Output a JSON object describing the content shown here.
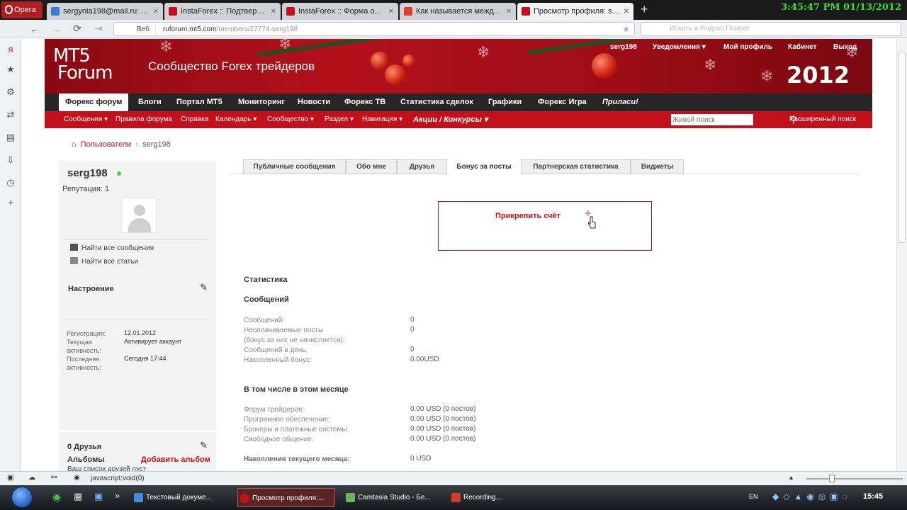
{
  "browser": {
    "menu_label": "Opera",
    "tabs": [
      {
        "title": "sergynia198@mail.ru: Д...",
        "favicon_color": "#3b7bd0"
      },
      {
        "title": "InstaForex :: Подтверж...",
        "favicon_color": "#c3101b"
      },
      {
        "title": "InstaForex :: Форма отк...",
        "favicon_color": "#c3101b"
      },
      {
        "title": "Как называется между...",
        "favicon_color": "#e23b2e"
      },
      {
        "title": "Просмотр профиля: ser...",
        "favicon_color": "#c3101b"
      }
    ],
    "clock": "3:45:47 PM 01/13/2012",
    "address": {
      "prefix": "Веб",
      "url_host": "ruforum.mt5.com",
      "url_path": "/members/27774-serg198"
    },
    "search_placeholder": "Искать в Яндекс.Поиске"
  },
  "site": {
    "logo_line1": "MT5",
    "logo_line2": "Forum",
    "tagline": "Сообщество Forex трейдеров",
    "year": "2012",
    "topnav": [
      "serg198",
      "Уведомления ▾",
      "Мой профиль",
      "Кабинет",
      "Выход"
    ],
    "main_menu": [
      "Форекс форум",
      "Блоги",
      "Портал MT5",
      "Мониторинг",
      "Новости",
      "Форекс ТВ",
      "Статистика сделок",
      "Графики",
      "Форекс Игра",
      "Приласи!"
    ],
    "sub_menu": [
      "Сообщения ▾",
      "Правила форума",
      "Справка",
      "Календарь ▾",
      "Сообщество ▾",
      "Раздел ▾",
      "Навигация ▾",
      "Акции / Конкурсы ▾"
    ],
    "live_search_placeholder": "Живой поиск",
    "advanced_search": "Расширенный поиск"
  },
  "breadcrumb": {
    "parent": "Пользователи",
    "current": "serg198"
  },
  "profile": {
    "username": "serg198",
    "reputation": "Репутация: 1",
    "find_posts": "Найти все сообщения",
    "find_articles": "Найти все статьи",
    "mood_title": "Настроение",
    "info": [
      {
        "label": "Регистрация:",
        "value": "12.01.2012"
      },
      {
        "label": "Текущая активность:",
        "value": "Активирует аккаунт"
      },
      {
        "label": "Последняя активность:",
        "value": "Сегодня 17:44"
      }
    ],
    "friends_title": "0 Друзья",
    "friends_empty": "Ваш список друзей пуст",
    "albums_title": "Альбомы",
    "add_album": "Добавить альбом"
  },
  "tabs": [
    "Публичные сообщения",
    "Обо мне",
    "Друзья",
    "Бонус за посты",
    "Партнерская статистика",
    "Виджеты"
  ],
  "active_tab": "Бонус за посты",
  "attach_account": "Прикрепить счёт",
  "stats": {
    "title": "Статистика",
    "messages_title": "Сообщений",
    "rows": [
      {
        "label": "Сообщений:",
        "value": "0"
      },
      {
        "label": "Неоплачиваемые посты",
        "value": "0"
      },
      {
        "label": "(бонус за них не начисляется):",
        "value": ""
      },
      {
        "label": "Сообщений в день:",
        "value": "0"
      },
      {
        "label": "Накопленный бонус:",
        "value": "0.00USD"
      }
    ],
    "month_title": "В том числе в этом месяце",
    "month_rows": [
      {
        "label": "Форум трейдеров:",
        "value": "0.00 USD (0 постов)"
      },
      {
        "label": "Програмное обеспечение:",
        "value": "0.00 USD (0 постов)"
      },
      {
        "label": "Брокеры и платежные системы:",
        "value": "0.00 USD (0 постов)"
      },
      {
        "label": "Свободное общение:",
        "value": "0.00 USD (0 постов)"
      }
    ],
    "accum_label": "Накопления текущего месяца:",
    "accum_value": "0 USD"
  },
  "statusbar": {
    "text": "javascript:void(0)"
  },
  "taskbar": {
    "items": [
      {
        "label": "Текстовый докуме...",
        "color": "#3d8de0"
      },
      {
        "label": "Просмотр профиля:...",
        "color": "#c3101b"
      },
      {
        "label": "Camtasia Studio - Бе...",
        "color": "#6bb35a"
      },
      {
        "label": "Recording...",
        "color": "#d63a2a"
      }
    ],
    "lang": "EN",
    "clock": "15:45"
  },
  "colors": {
    "brand_red": "#c3101b",
    "menu_dark": "#262626",
    "online_green": "#59c35a"
  }
}
